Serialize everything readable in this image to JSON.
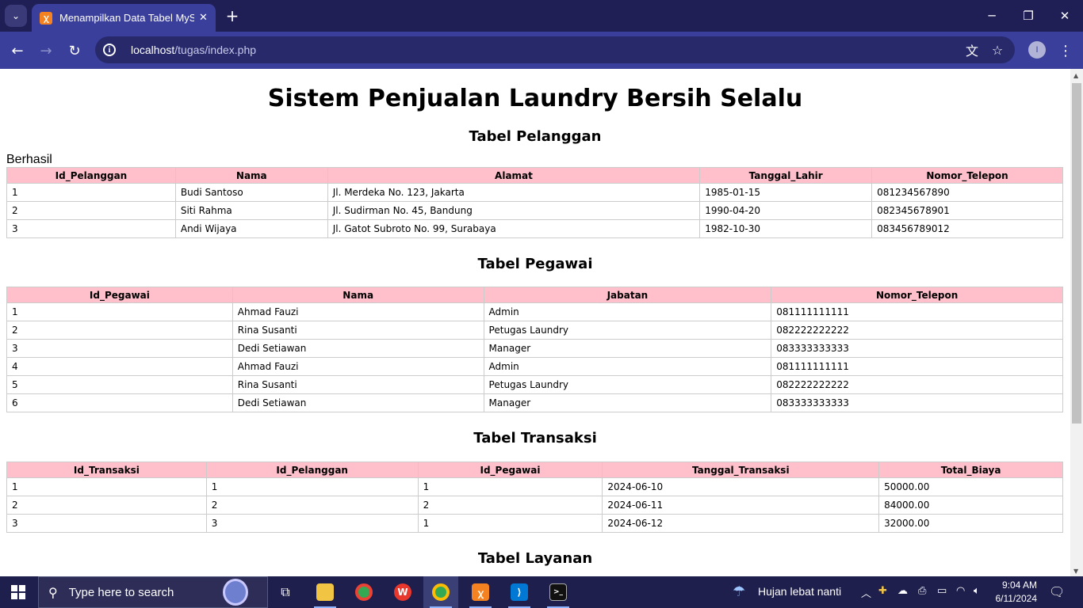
{
  "browser": {
    "tab_title": "Menampilkan Data Tabel MySQL",
    "url_host": "localhost",
    "url_path": "/tugas/index.php",
    "profile_initial": "I"
  },
  "page": {
    "title": "Sistem Penjualan Laundry Bersih Selalu",
    "status": "Berhasil",
    "pelanggan": {
      "heading": "Tabel Pelanggan",
      "headers": [
        "Id_Pelanggan",
        "Nama",
        "Alamat",
        "Tanggal_Lahir",
        "Nomor_Telepon"
      ],
      "rows": [
        [
          "1",
          "Budi Santoso",
          "Jl. Merdeka No. 123, Jakarta",
          "1985-01-15",
          "081234567890"
        ],
        [
          "2",
          "Siti Rahma",
          "Jl. Sudirman No. 45, Bandung",
          "1990-04-20",
          "082345678901"
        ],
        [
          "3",
          "Andi Wijaya",
          "Jl. Gatot Subroto No. 99, Surabaya",
          "1982-10-30",
          "083456789012"
        ]
      ]
    },
    "pegawai": {
      "heading": "Tabel Pegawai",
      "headers": [
        "Id_Pegawai",
        "Nama",
        "Jabatan",
        "Nomor_Telepon"
      ],
      "rows": [
        [
          "1",
          "Ahmad Fauzi",
          "Admin",
          "081111111111"
        ],
        [
          "2",
          "Rina Susanti",
          "Petugas Laundry",
          "082222222222"
        ],
        [
          "3",
          "Dedi Setiawan",
          "Manager",
          "083333333333"
        ],
        [
          "4",
          "Ahmad Fauzi",
          "Admin",
          "081111111111"
        ],
        [
          "5",
          "Rina Susanti",
          "Petugas Laundry",
          "082222222222"
        ],
        [
          "6",
          "Dedi Setiawan",
          "Manager",
          "083333333333"
        ]
      ]
    },
    "transaksi": {
      "heading": "Tabel Transaksi",
      "headers": [
        "Id_Transaksi",
        "Id_Pelanggan",
        "Id_Pegawai",
        "Tanggal_Transaksi",
        "Total_Biaya"
      ],
      "rows": [
        [
          "1",
          "1",
          "1",
          "2024-06-10",
          "50000.00"
        ],
        [
          "2",
          "2",
          "2",
          "2024-06-11",
          "84000.00"
        ],
        [
          "3",
          "3",
          "1",
          "2024-06-12",
          "32000.00"
        ]
      ]
    },
    "layanan": {
      "heading": "Tabel Layanan"
    }
  },
  "taskbar": {
    "search_placeholder": "Type here to search",
    "weather": "Hujan lebat nanti",
    "time": "9:04 AM",
    "date": "6/11/2024"
  },
  "icons": {
    "back": "arrow-left-icon",
    "forward": "arrow-right-icon",
    "reload": "reload-icon",
    "translate": "translate-icon",
    "bookmark": "star-icon",
    "menu": "kebab-menu-icon"
  },
  "colors": {
    "header_bg": "#ffc0cb",
    "chrome_bg": "#1f1f55",
    "toolbar_bg": "#3a3f9c"
  }
}
